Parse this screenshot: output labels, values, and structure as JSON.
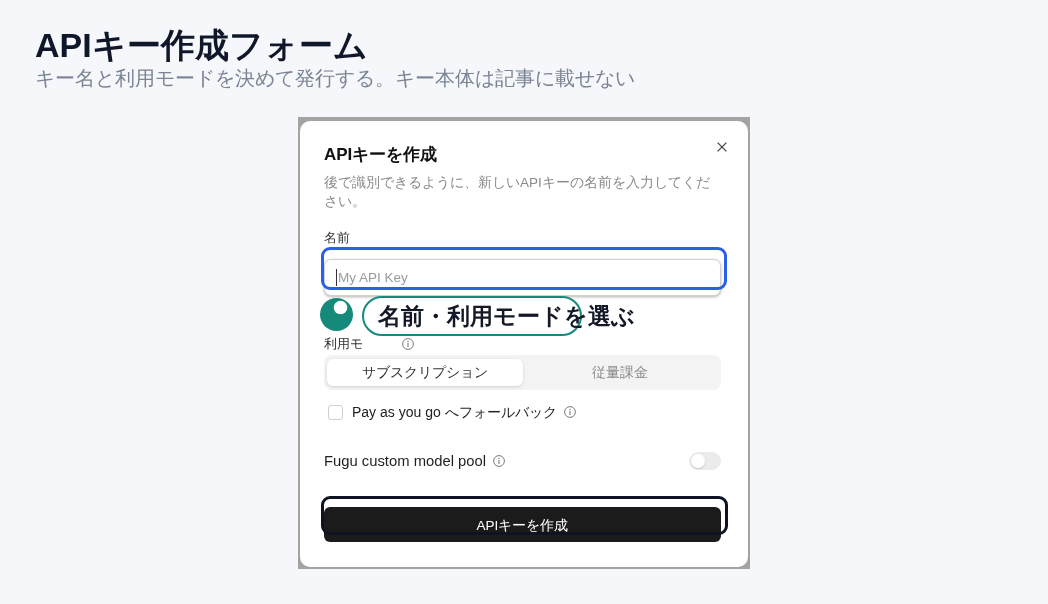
{
  "page": {
    "title": "APIキー作成フォーム",
    "subtitle": "キー名と利用モードを決めて発行する。キー本体は記事に載せない"
  },
  "dialog": {
    "title": "APIキーを作成",
    "description": "後で識別できるように、新しいAPIキーの名前を入力してください。",
    "name_field": {
      "label": "名前",
      "placeholder": "My API Key",
      "highlight": {
        "color": "#2a60e8"
      }
    },
    "mode_field": {
      "label": "利用モ",
      "segments": [
        {
          "label": "サブスクリプション",
          "selected": true
        },
        {
          "label": "従量課金",
          "selected": false
        }
      ]
    },
    "fallback_option": {
      "label": "Pay as you go へフォールバック",
      "checked": false
    },
    "custom_pool": {
      "label": "Fugu custom model pool",
      "on": false
    },
    "submit_button": {
      "label": "APIキーを作成",
      "highlight": {
        "color": "#0d1322"
      }
    }
  },
  "callout": {
    "text": "名前・利用モードを選ぶ"
  }
}
